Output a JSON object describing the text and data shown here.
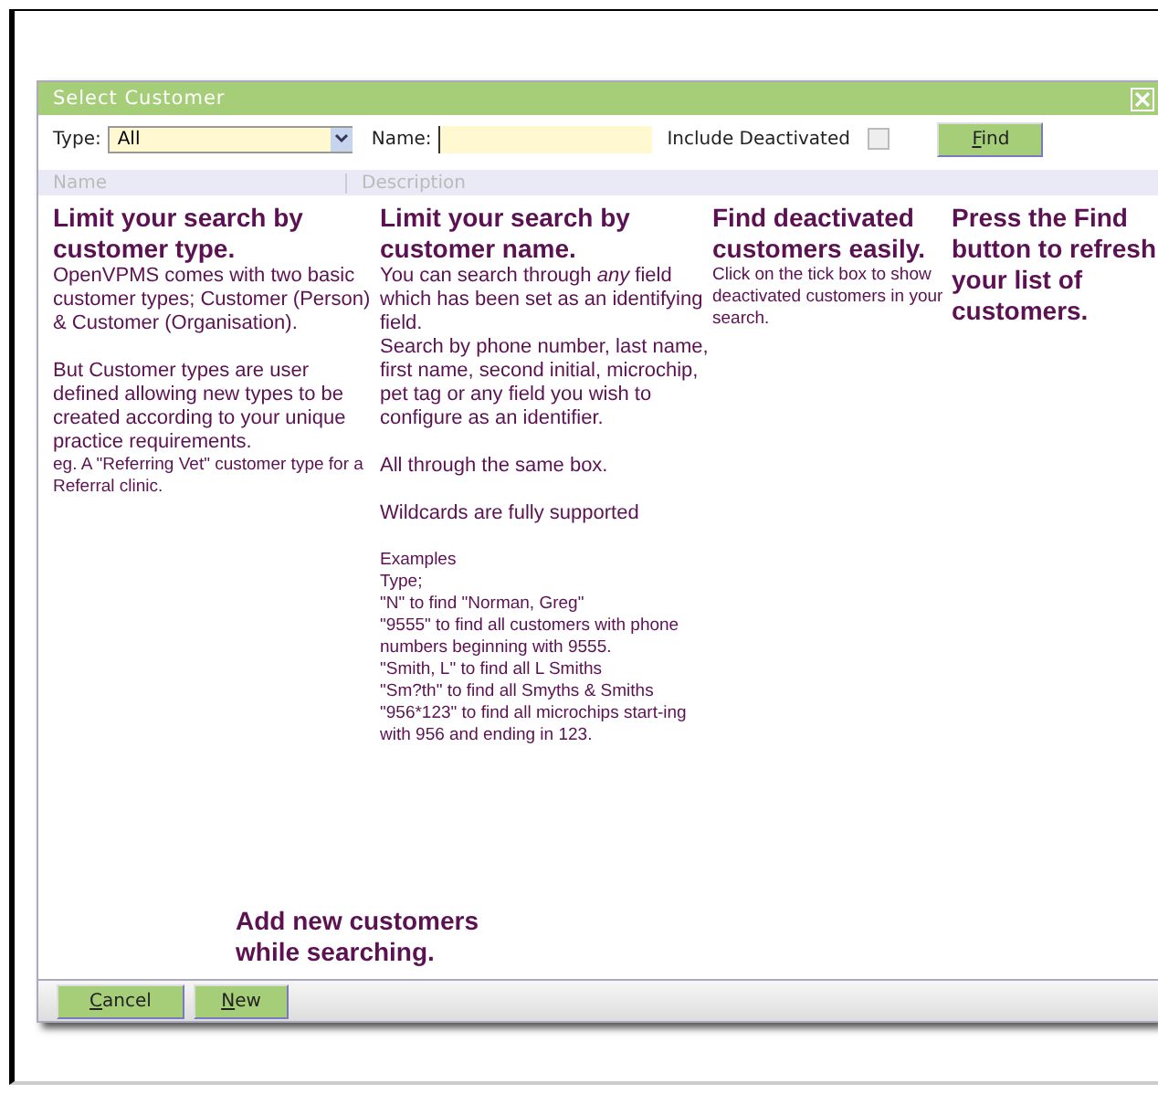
{
  "window": {
    "title": "Select Customer"
  },
  "toolbar": {
    "type_label": "Type:",
    "type_value": "All",
    "name_label": "Name:",
    "include_label": "Include Deactivated",
    "include_checked": false,
    "find": {
      "accesskey": "F",
      "rest": "ind"
    }
  },
  "table": {
    "columns": [
      "Name",
      "Description"
    ]
  },
  "notes": [
    {
      "heading": "Limit your search by customer type.",
      "paragraphs": [
        {
          "kind": "normal",
          "text": "OpenVPMS comes with two basic customer types; Customer (Person) & Customer (Organisation)."
        },
        {
          "kind": "normal",
          "text": "But Customer types are user defined allowing new types to be created according to your unique practice requirements."
        },
        {
          "kind": "small",
          "text": "eg. A \"Referring Vet\" customer type for a Referral clinic."
        }
      ]
    },
    {
      "heading": "Limit your search by customer name.",
      "paragraphs": [
        {
          "kind": "normal",
          "text": "You can search through *any* field which has been set as an identifying field."
        },
        {
          "kind": "normal",
          "text": "Search by phone number, last name, first name, second initial, microchip, pet tag or any field you wish to configure as an identifier."
        },
        {
          "kind": "normal",
          "text": "All through the same box."
        },
        {
          "kind": "normal",
          "text": "Wildcards are fully supported"
        },
        {
          "kind": "small",
          "text": "Examples"
        },
        {
          "kind": "small",
          "text": "Type;"
        },
        {
          "kind": "small",
          "text": "\"N\" to find \"Norman, Greg\""
        },
        {
          "kind": "small",
          "text": "\"9555\" to find all customers with phone numbers beginning with 9555."
        },
        {
          "kind": "small",
          "text": "\"Smith, L\" to find all L Smiths"
        },
        {
          "kind": "small",
          "text": "\"Sm?th\" to find all Smyths & Smiths"
        },
        {
          "kind": "small",
          "text": "\"956*123\" to find all microchips start-ing with 956 and ending in 123."
        }
      ]
    },
    {
      "heading": "Find deactivated customers easily.",
      "paragraphs": [
        {
          "kind": "small",
          "text": "Click on the tick box to show deactivated customers in your search."
        }
      ]
    },
    {
      "heading": "Press the Find button to refresh your list of customers."
    }
  ],
  "bottom_note": {
    "heading": "Add new customers while searching."
  },
  "buttons": [
    {
      "accesskey": "C",
      "rest": "ancel"
    },
    {
      "accesskey": "N",
      "rest": "ew"
    }
  ]
}
